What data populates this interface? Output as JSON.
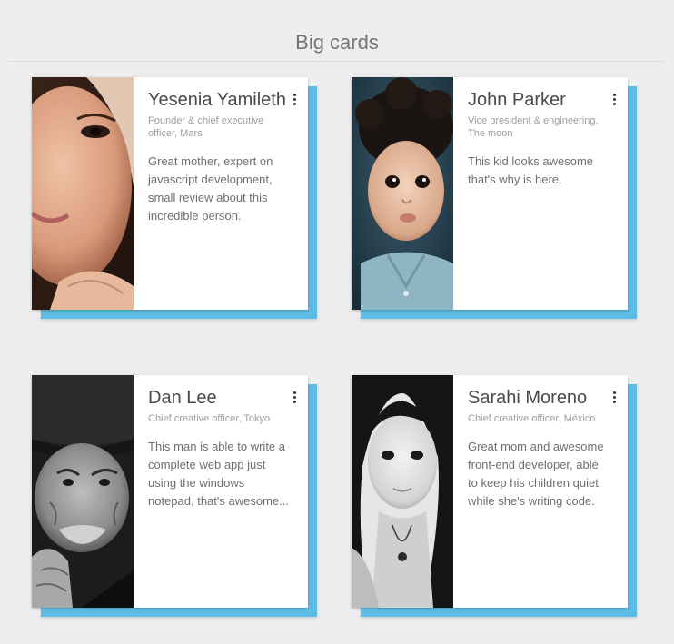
{
  "page": {
    "title": "Big cards"
  },
  "cards": [
    {
      "name": "Yesenia Yamileth",
      "role": "Founder & chief executive officer, Mars",
      "description": "Great mother, expert on javascript development, small review about this incredible person.",
      "photo_icon": "woman-portrait-photo",
      "menu_icon": "more-vert-icon"
    },
    {
      "name": "John Parker",
      "role": "Vice president & engineering, The moon",
      "description": "This kid looks awesome that's why is here.",
      "photo_icon": "child-portrait-photo",
      "menu_icon": "more-vert-icon"
    },
    {
      "name": "Dan Lee",
      "role": "Chief creative officer, Tokyo",
      "description": "This man is able to write a complete web app just using the windows notepad, that's awesome...",
      "photo_icon": "old-man-portrait-photo",
      "menu_icon": "more-vert-icon"
    },
    {
      "name": "Sarahi Moreno",
      "role": "Chief creative officer, México",
      "description": "Great mom and awesome front-end developer, able to keep his children quiet while she's writing code.",
      "photo_icon": "woman-bw-portrait-photo",
      "menu_icon": "more-vert-icon"
    }
  ],
  "colors": {
    "background": "#eeeeee",
    "card_accent": "#5bbde4",
    "card_background": "#ffffff",
    "name_text": "#4a4a4a",
    "role_text": "#9e9e9e",
    "description_text": "#6f6f6f"
  }
}
